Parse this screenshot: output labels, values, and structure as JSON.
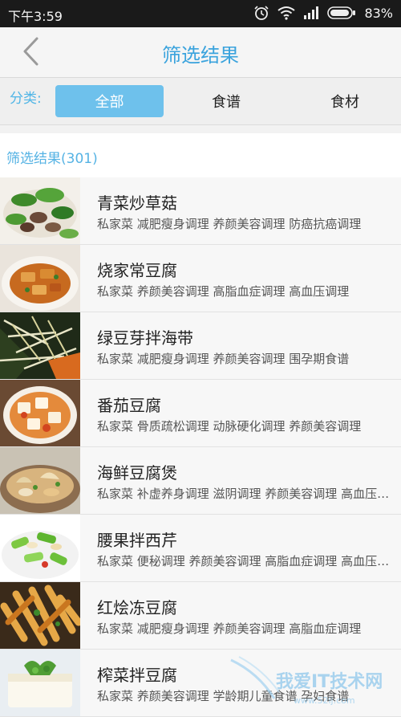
{
  "status_bar": {
    "time": "下午3:59",
    "battery": "83%",
    "icons": [
      "alarm-icon",
      "wifi-icon",
      "signal-icon",
      "battery-icon"
    ]
  },
  "nav": {
    "title": "筛选结果",
    "back_icon": "chevron-left-icon"
  },
  "filter": {
    "label": "分类:",
    "options": [
      "全部",
      "食谱",
      "食材"
    ],
    "selected": "全部"
  },
  "results": {
    "header": "筛选结果(301)",
    "items": [
      {
        "title": "青菜炒草菇",
        "tags": "私家菜 减肥瘦身调理 养颜美容调理 防癌抗癌调理"
      },
      {
        "title": "烧家常豆腐",
        "tags": "私家菜 养颜美容调理 高脂血症调理 高血压调理"
      },
      {
        "title": "绿豆芽拌海带",
        "tags": "私家菜 减肥瘦身调理 养颜美容调理 围孕期食谱"
      },
      {
        "title": "番茄豆腐",
        "tags": "私家菜 骨质疏松调理 动脉硬化调理 养颜美容调理"
      },
      {
        "title": "海鲜豆腐煲",
        "tags": "私家菜 补虚养身调理 滋阴调理 养颜美容调理 高血压调理"
      },
      {
        "title": "腰果拌西芹",
        "tags": "私家菜 便秘调理 养颜美容调理 高脂血症调理 高血压调理"
      },
      {
        "title": "红烩冻豆腐",
        "tags": "私家菜 减肥瘦身调理 养颜美容调理 高脂血症调理"
      },
      {
        "title": "榨菜拌豆腐",
        "tags": "私家菜 养颜美容调理 学龄期儿童食谱 孕妇食谱"
      }
    ]
  },
  "watermark": {
    "text": "我爱IT技术网",
    "url": "www.52ij.com"
  },
  "colors": {
    "accent": "#3aa3dd",
    "selected_tab": "#6ec1ec",
    "status_bar": "#1a1a1a"
  }
}
